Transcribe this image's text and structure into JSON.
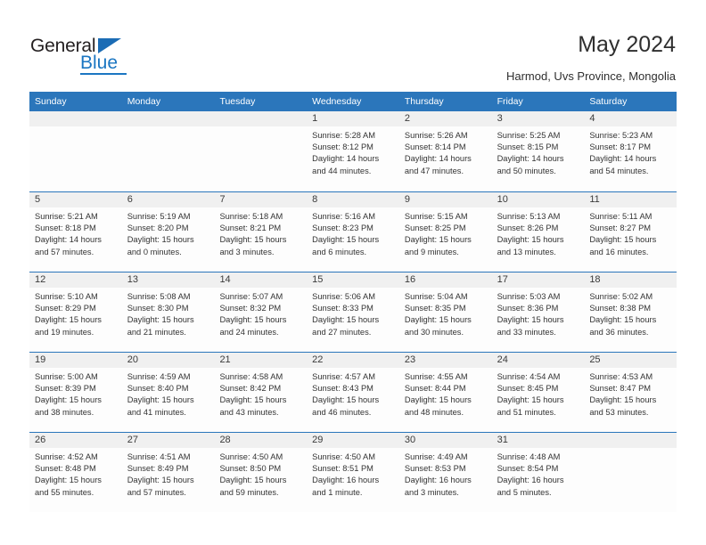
{
  "brand": {
    "name_part1": "General",
    "name_part2": "Blue"
  },
  "header": {
    "title": "May 2024",
    "subtitle": "Harmod, Uvs Province, Mongolia"
  },
  "colors": {
    "header_blue": "#2b76bb",
    "brand_blue": "#1b76c2",
    "date_strip": "#f0f0f0",
    "text": "#333333"
  },
  "weekdays": [
    "Sunday",
    "Monday",
    "Tuesday",
    "Wednesday",
    "Thursday",
    "Friday",
    "Saturday"
  ],
  "weeks": [
    [
      {
        "day": "",
        "empty": true
      },
      {
        "day": "",
        "empty": true
      },
      {
        "day": "",
        "empty": true
      },
      {
        "day": "1",
        "sunrise": "Sunrise: 5:28 AM",
        "sunset": "Sunset: 8:12 PM",
        "daylight1": "Daylight: 14 hours",
        "daylight2": "and 44 minutes."
      },
      {
        "day": "2",
        "sunrise": "Sunrise: 5:26 AM",
        "sunset": "Sunset: 8:14 PM",
        "daylight1": "Daylight: 14 hours",
        "daylight2": "and 47 minutes."
      },
      {
        "day": "3",
        "sunrise": "Sunrise: 5:25 AM",
        "sunset": "Sunset: 8:15 PM",
        "daylight1": "Daylight: 14 hours",
        "daylight2": "and 50 minutes."
      },
      {
        "day": "4",
        "sunrise": "Sunrise: 5:23 AM",
        "sunset": "Sunset: 8:17 PM",
        "daylight1": "Daylight: 14 hours",
        "daylight2": "and 54 minutes."
      }
    ],
    [
      {
        "day": "5",
        "sunrise": "Sunrise: 5:21 AM",
        "sunset": "Sunset: 8:18 PM",
        "daylight1": "Daylight: 14 hours",
        "daylight2": "and 57 minutes."
      },
      {
        "day": "6",
        "sunrise": "Sunrise: 5:19 AM",
        "sunset": "Sunset: 8:20 PM",
        "daylight1": "Daylight: 15 hours",
        "daylight2": "and 0 minutes."
      },
      {
        "day": "7",
        "sunrise": "Sunrise: 5:18 AM",
        "sunset": "Sunset: 8:21 PM",
        "daylight1": "Daylight: 15 hours",
        "daylight2": "and 3 minutes."
      },
      {
        "day": "8",
        "sunrise": "Sunrise: 5:16 AM",
        "sunset": "Sunset: 8:23 PM",
        "daylight1": "Daylight: 15 hours",
        "daylight2": "and 6 minutes."
      },
      {
        "day": "9",
        "sunrise": "Sunrise: 5:15 AM",
        "sunset": "Sunset: 8:25 PM",
        "daylight1": "Daylight: 15 hours",
        "daylight2": "and 9 minutes."
      },
      {
        "day": "10",
        "sunrise": "Sunrise: 5:13 AM",
        "sunset": "Sunset: 8:26 PM",
        "daylight1": "Daylight: 15 hours",
        "daylight2": "and 13 minutes."
      },
      {
        "day": "11",
        "sunrise": "Sunrise: 5:11 AM",
        "sunset": "Sunset: 8:27 PM",
        "daylight1": "Daylight: 15 hours",
        "daylight2": "and 16 minutes."
      }
    ],
    [
      {
        "day": "12",
        "sunrise": "Sunrise: 5:10 AM",
        "sunset": "Sunset: 8:29 PM",
        "daylight1": "Daylight: 15 hours",
        "daylight2": "and 19 minutes."
      },
      {
        "day": "13",
        "sunrise": "Sunrise: 5:08 AM",
        "sunset": "Sunset: 8:30 PM",
        "daylight1": "Daylight: 15 hours",
        "daylight2": "and 21 minutes."
      },
      {
        "day": "14",
        "sunrise": "Sunrise: 5:07 AM",
        "sunset": "Sunset: 8:32 PM",
        "daylight1": "Daylight: 15 hours",
        "daylight2": "and 24 minutes."
      },
      {
        "day": "15",
        "sunrise": "Sunrise: 5:06 AM",
        "sunset": "Sunset: 8:33 PM",
        "daylight1": "Daylight: 15 hours",
        "daylight2": "and 27 minutes."
      },
      {
        "day": "16",
        "sunrise": "Sunrise: 5:04 AM",
        "sunset": "Sunset: 8:35 PM",
        "daylight1": "Daylight: 15 hours",
        "daylight2": "and 30 minutes."
      },
      {
        "day": "17",
        "sunrise": "Sunrise: 5:03 AM",
        "sunset": "Sunset: 8:36 PM",
        "daylight1": "Daylight: 15 hours",
        "daylight2": "and 33 minutes."
      },
      {
        "day": "18",
        "sunrise": "Sunrise: 5:02 AM",
        "sunset": "Sunset: 8:38 PM",
        "daylight1": "Daylight: 15 hours",
        "daylight2": "and 36 minutes."
      }
    ],
    [
      {
        "day": "19",
        "sunrise": "Sunrise: 5:00 AM",
        "sunset": "Sunset: 8:39 PM",
        "daylight1": "Daylight: 15 hours",
        "daylight2": "and 38 minutes."
      },
      {
        "day": "20",
        "sunrise": "Sunrise: 4:59 AM",
        "sunset": "Sunset: 8:40 PM",
        "daylight1": "Daylight: 15 hours",
        "daylight2": "and 41 minutes."
      },
      {
        "day": "21",
        "sunrise": "Sunrise: 4:58 AM",
        "sunset": "Sunset: 8:42 PM",
        "daylight1": "Daylight: 15 hours",
        "daylight2": "and 43 minutes."
      },
      {
        "day": "22",
        "sunrise": "Sunrise: 4:57 AM",
        "sunset": "Sunset: 8:43 PM",
        "daylight1": "Daylight: 15 hours",
        "daylight2": "and 46 minutes."
      },
      {
        "day": "23",
        "sunrise": "Sunrise: 4:55 AM",
        "sunset": "Sunset: 8:44 PM",
        "daylight1": "Daylight: 15 hours",
        "daylight2": "and 48 minutes."
      },
      {
        "day": "24",
        "sunrise": "Sunrise: 4:54 AM",
        "sunset": "Sunset: 8:45 PM",
        "daylight1": "Daylight: 15 hours",
        "daylight2": "and 51 minutes."
      },
      {
        "day": "25",
        "sunrise": "Sunrise: 4:53 AM",
        "sunset": "Sunset: 8:47 PM",
        "daylight1": "Daylight: 15 hours",
        "daylight2": "and 53 minutes."
      }
    ],
    [
      {
        "day": "26",
        "sunrise": "Sunrise: 4:52 AM",
        "sunset": "Sunset: 8:48 PM",
        "daylight1": "Daylight: 15 hours",
        "daylight2": "and 55 minutes."
      },
      {
        "day": "27",
        "sunrise": "Sunrise: 4:51 AM",
        "sunset": "Sunset: 8:49 PM",
        "daylight1": "Daylight: 15 hours",
        "daylight2": "and 57 minutes."
      },
      {
        "day": "28",
        "sunrise": "Sunrise: 4:50 AM",
        "sunset": "Sunset: 8:50 PM",
        "daylight1": "Daylight: 15 hours",
        "daylight2": "and 59 minutes."
      },
      {
        "day": "29",
        "sunrise": "Sunrise: 4:50 AM",
        "sunset": "Sunset: 8:51 PM",
        "daylight1": "Daylight: 16 hours",
        "daylight2": "and 1 minute."
      },
      {
        "day": "30",
        "sunrise": "Sunrise: 4:49 AM",
        "sunset": "Sunset: 8:53 PM",
        "daylight1": "Daylight: 16 hours",
        "daylight2": "and 3 minutes."
      },
      {
        "day": "31",
        "sunrise": "Sunrise: 4:48 AM",
        "sunset": "Sunset: 8:54 PM",
        "daylight1": "Daylight: 16 hours",
        "daylight2": "and 5 minutes."
      },
      {
        "day": "",
        "empty": true
      }
    ]
  ]
}
